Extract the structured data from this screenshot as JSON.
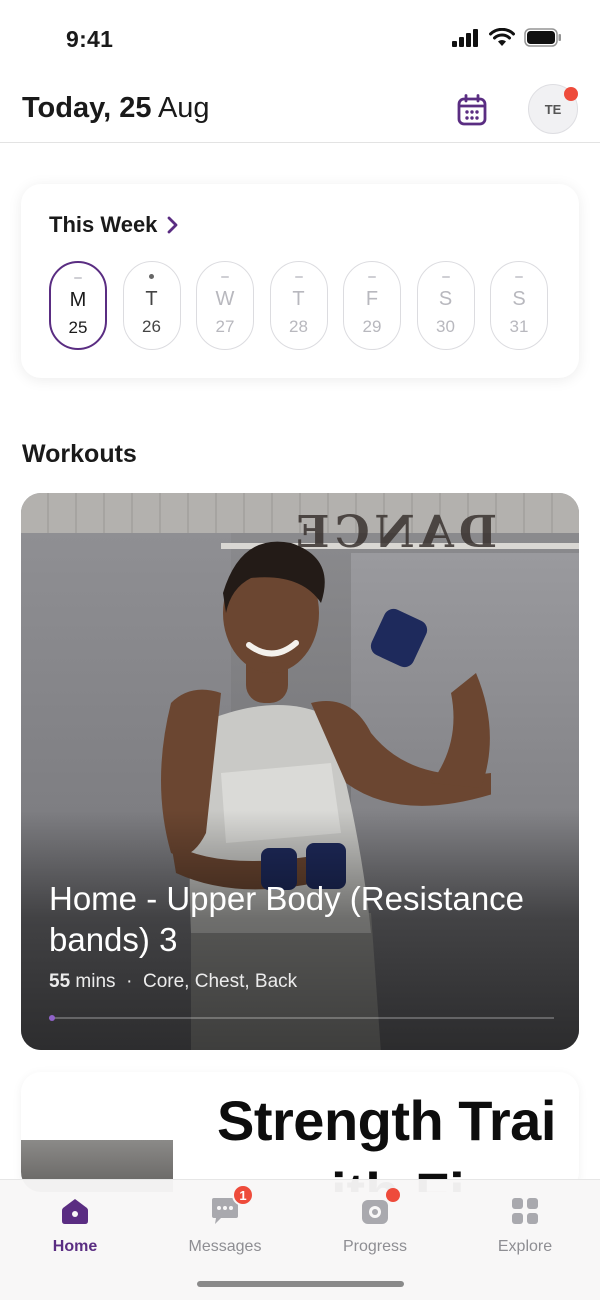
{
  "status_bar": {
    "time": "9:41"
  },
  "header": {
    "today_bold": "Today, 25",
    "month": "Aug",
    "avatar_initials": "TE"
  },
  "week": {
    "heading": "This Week",
    "days": [
      {
        "letter": "M",
        "num": "25"
      },
      {
        "letter": "T",
        "num": "26"
      },
      {
        "letter": "W",
        "num": "27"
      },
      {
        "letter": "T",
        "num": "28"
      },
      {
        "letter": "F",
        "num": "29"
      },
      {
        "letter": "S",
        "num": "30"
      },
      {
        "letter": "S",
        "num": "31"
      }
    ]
  },
  "workouts": {
    "section_title": "Workouts",
    "featured": {
      "title": "Home - Upper Body (Resistance bands) 3",
      "duration_value": "55",
      "duration_unit": "mins",
      "separator": "·",
      "muscles": "Core, Chest, Back",
      "background_sign": "DANCE"
    },
    "next": {
      "title_line1": "Strength Trai",
      "title_line2": "ith Fi"
    }
  },
  "tab_bar": {
    "tabs": [
      {
        "label": "Home",
        "icon": "home-icon"
      },
      {
        "label": "Messages",
        "icon": "messages-icon",
        "badge": "1"
      },
      {
        "label": "Progress",
        "icon": "progress-icon"
      },
      {
        "label": "Explore",
        "icon": "explore-icon"
      }
    ]
  },
  "colors": {
    "accent": "#5a2d82",
    "notification": "#ee4b3b",
    "inactive": "#8e8e93"
  }
}
